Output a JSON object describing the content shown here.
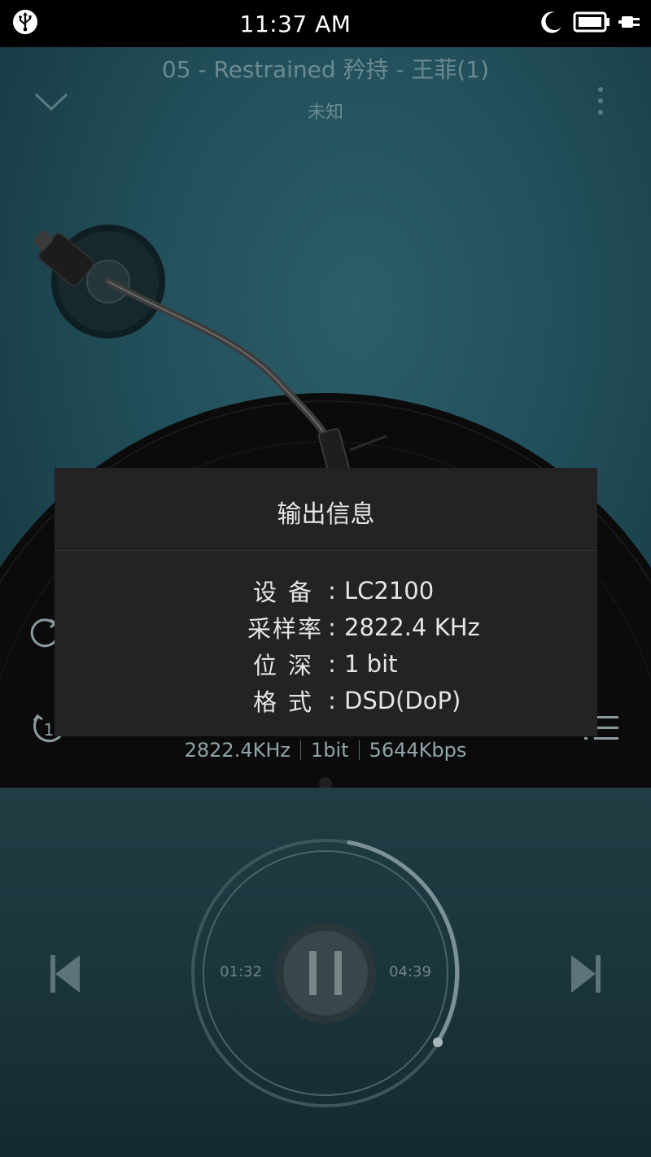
{
  "status": {
    "time": "11:37 AM",
    "icons": [
      "usb-icon",
      "moon-icon",
      "battery-icon",
      "charging-plug-icon"
    ]
  },
  "track": {
    "title": "05 - Restrained 矜持 - 王菲(1)",
    "artist": "未知"
  },
  "dialog": {
    "title": "输出信息",
    "rows": [
      {
        "label": "设备",
        "value": "LC2100"
      },
      {
        "label": "采样率",
        "value": "2822.4 KHz"
      },
      {
        "label": "位深",
        "value": "1 bit"
      },
      {
        "label": "格式",
        "value": "DSD(DoP)"
      }
    ]
  },
  "format_info": {
    "sample_rate": "2822.4KHz",
    "bit_depth": "1bit",
    "bitrate": "5644Kbps"
  },
  "playback": {
    "elapsed": "01:32",
    "total": "04:39",
    "progress": 0.33,
    "repeat_count": "1"
  },
  "colors": {
    "accent": "#2d5d6a",
    "dialog_bg": "#232323"
  }
}
